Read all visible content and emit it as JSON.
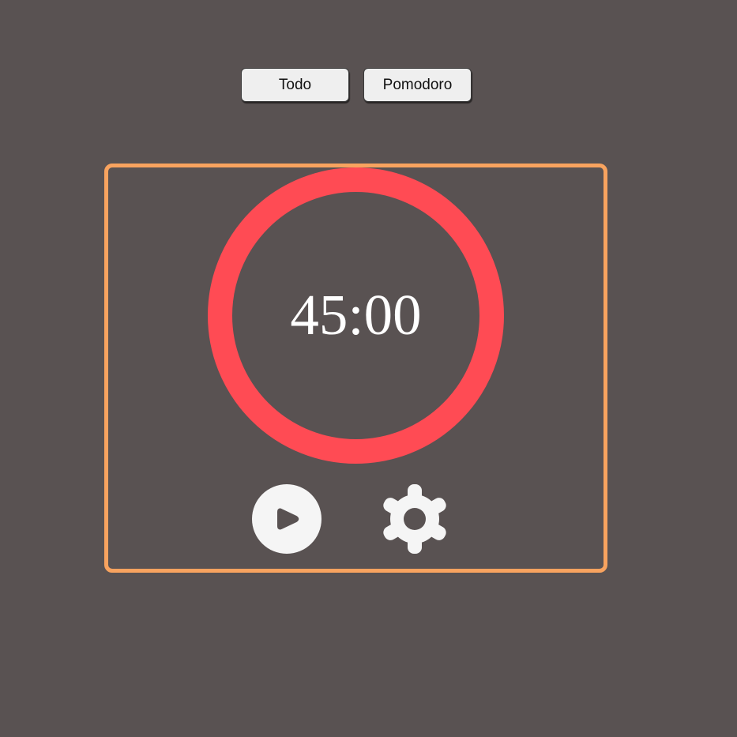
{
  "nav": {
    "tabs": [
      {
        "label": "Todo"
      },
      {
        "label": "Pomodoro"
      }
    ]
  },
  "timer": {
    "display": "45:00",
    "progress": 1.0,
    "ring_color": "#ff4b54"
  },
  "controls": {
    "play_icon": "play-icon",
    "settings_icon": "gear-icon"
  },
  "theme": {
    "background": "#595252",
    "panel_border": "#f8a35f",
    "icon_color": "#f5f5f5"
  }
}
